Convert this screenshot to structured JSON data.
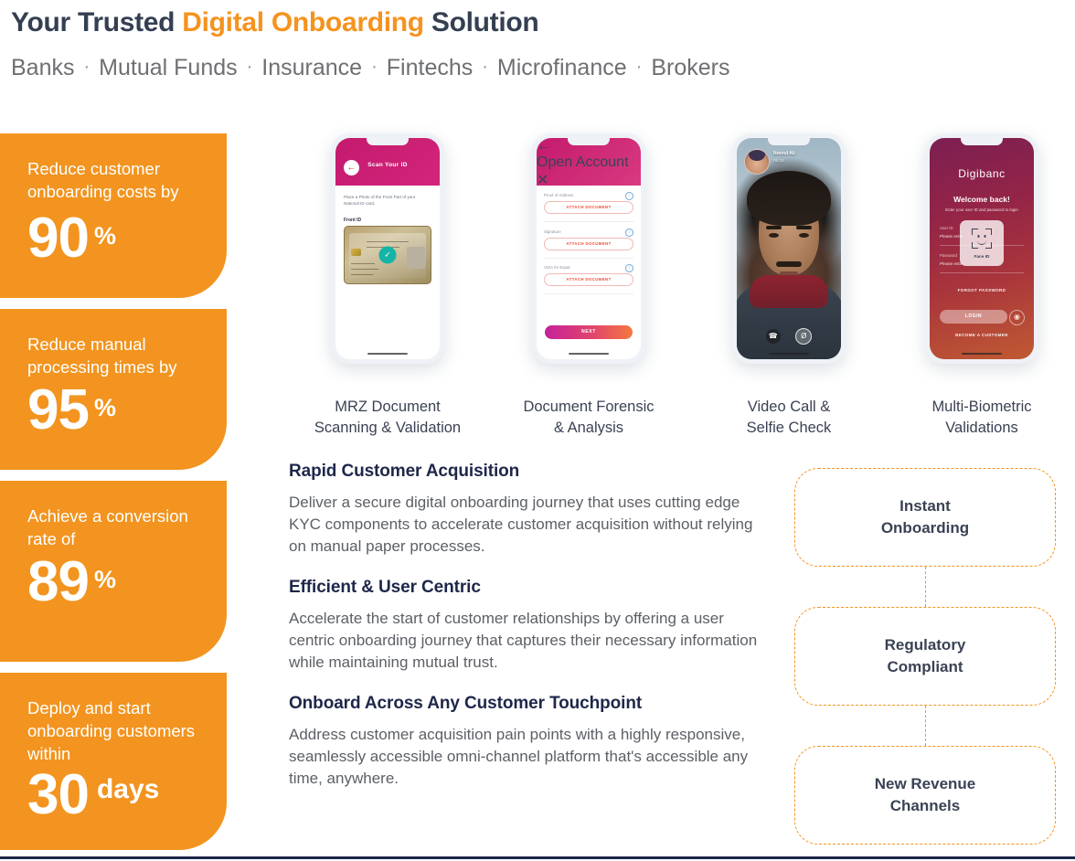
{
  "header": {
    "title_part1": "Your Trusted ",
    "title_accent": "Digital Onboarding",
    "title_part2": " Solution",
    "segments": [
      "Banks",
      "Mutual Funds",
      "Insurance",
      "Fintechs",
      "Microfinance",
      "Brokers"
    ],
    "separator": "·"
  },
  "colors": {
    "orange": "#f2941f",
    "accent_orange": "#f5931e",
    "dark_navy": "#1e2749",
    "slate": "#3a4254",
    "body_gray": "#5c6066",
    "magenta": "#c41a6e",
    "teal": "#14b5a6"
  },
  "stats": [
    {
      "label": "Reduce customer onboarding costs by",
      "value": "90",
      "unit": "%"
    },
    {
      "label": "Reduce manual processing times by",
      "value": "95",
      "unit": "%"
    },
    {
      "label": "Achieve a conversion rate of",
      "value": "89",
      "unit": "%"
    },
    {
      "label": "Deploy and start onboarding customers within",
      "value": "30",
      "unit": "days"
    }
  ],
  "phones": [
    {
      "caption_line1": "MRZ Document",
      "caption_line2": "Scanning & Validation",
      "header_title": "Scan Your ID",
      "instruction": "Place a Photo of the Front Part of your National ID card.",
      "field_label": "Front ID",
      "back_icon": "←",
      "check_icon": "✓"
    },
    {
      "caption_line1": "Document Forensic",
      "caption_line2": "& Analysis",
      "header_title": "Open Account",
      "back_icon": "←",
      "close_icon": "✕",
      "info_icon": "i",
      "fields": [
        {
          "label": "Proof of Address",
          "button": "ATTACH DOCUMENT"
        },
        {
          "label": "Signature",
          "button": "ATTACH DOCUMENT"
        },
        {
          "label": "VISA for Expat",
          "button": "ATTACH DOCUMENT"
        }
      ],
      "next_button": "NEXT"
    },
    {
      "caption_line1": "Video Call &",
      "caption_line2": "Selfie Check",
      "caller_name": "Noorul Ali",
      "call_timer": "05:23",
      "end_call_icon": "☎",
      "mute_icon": "Ø"
    },
    {
      "caption_line1": "Multi-Biometric",
      "caption_line2": "Validations",
      "brand": "Digibanc",
      "welcome": "Welcome back!",
      "subtitle": "Enter your user ID and password to login",
      "user_label": "User ID",
      "user_placeholder": "Please enter",
      "password_label": "Password",
      "password_placeholder": "Please enter",
      "faceid_label": "Face ID",
      "forgot": "FORGOT PASSWORD",
      "login": "LOGIN",
      "fingerprint_icon": "◉",
      "become_customer": "BECOME A CUSTOMER"
    }
  ],
  "features": [
    {
      "heading": "Rapid Customer Acquisition",
      "body": "Deliver a secure digital onboarding journey that uses cutting edge KYC components to accelerate customer acquisition without relying on manual paper processes."
    },
    {
      "heading": "Efficient & User Centric",
      "body": "Accelerate the start of customer relationships by offering a user centric onboarding journey that captures their necessary information while maintaining mutual trust."
    },
    {
      "heading": "Onboard Across Any Customer Touchpoint",
      "body": "Address customer acquisition pain points with a highly responsive, seamlessly accessible omni-channel platform that's accessible any time, anywhere."
    }
  ],
  "flow": [
    {
      "line1": "Instant",
      "line2": "Onboarding"
    },
    {
      "line1": "Regulatory",
      "line2": "Compliant"
    },
    {
      "line1": "New Revenue",
      "line2": "Channels"
    }
  ]
}
